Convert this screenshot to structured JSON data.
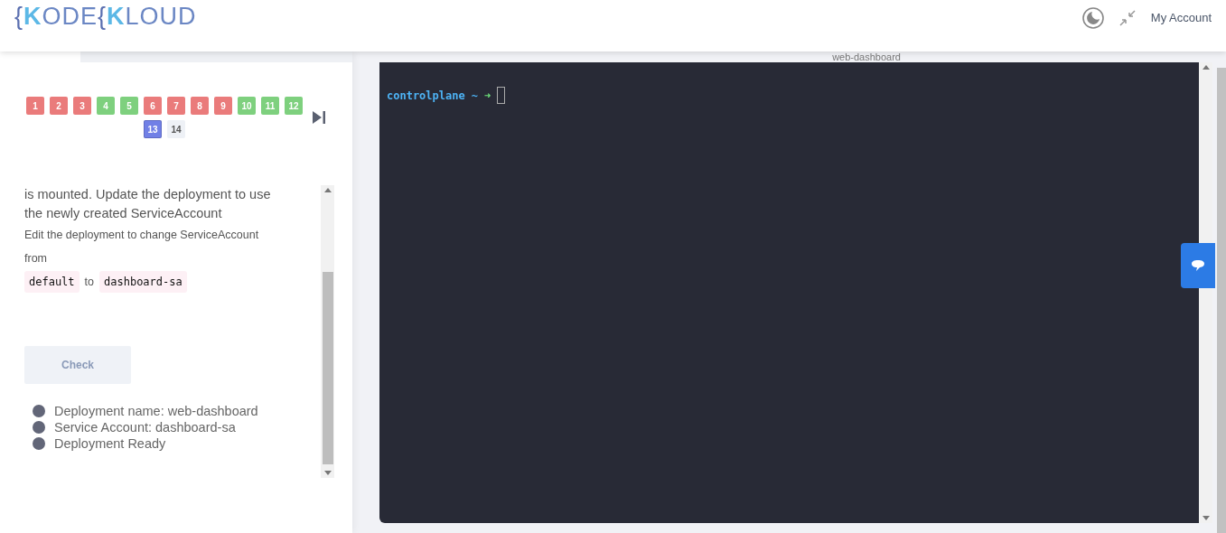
{
  "header": {
    "logo": {
      "brace": "{",
      "k": "K",
      "ode": "ODE",
      "brace2": "{",
      "k2": "K",
      "loud": "LOUD"
    },
    "account": "My Account"
  },
  "terminal_tab": {
    "label": "web-dashboard"
  },
  "questions": [
    {
      "label": "1",
      "color": "#ea7b7b",
      "selected": false
    },
    {
      "label": "2",
      "color": "#ea7b7b",
      "selected": false
    },
    {
      "label": "3",
      "color": "#ea7b7b",
      "selected": false
    },
    {
      "label": "4",
      "color": "#7ed07e",
      "selected": false
    },
    {
      "label": "5",
      "color": "#7ed07e",
      "selected": false
    },
    {
      "label": "6",
      "color": "#ea7b7b",
      "selected": false
    },
    {
      "label": "7",
      "color": "#ea7b7b",
      "selected": false
    },
    {
      "label": "8",
      "color": "#ea7b7b",
      "selected": false
    },
    {
      "label": "9",
      "color": "#ea7b7b",
      "selected": false
    },
    {
      "label": "10",
      "color": "#7ed07e",
      "selected": false
    },
    {
      "label": "11",
      "color": "#7ed07e",
      "selected": false
    },
    {
      "label": "12",
      "color": "#7ed07e",
      "selected": false
    },
    {
      "label": "13",
      "color": "#7180e6",
      "selected": true
    },
    {
      "label": "14",
      "color": "#eef1f6",
      "selected": false
    }
  ],
  "task": {
    "intro": "is mounted. Update the deployment to use the newly created ServiceAccount",
    "hint": [
      {
        "kind": "text",
        "text": "Edit the deployment to change ServiceAccount from"
      },
      {
        "kind": "code",
        "text": "default"
      },
      {
        "kind": "text",
        "text": "to"
      },
      {
        "kind": "code",
        "text": "dashboard-sa"
      }
    ],
    "check_button": "Check",
    "checks": [
      "Deployment name: web-dashboard",
      "Service Account: dashboard-sa",
      "Deployment Ready"
    ]
  },
  "terminal": {
    "host": "controlplane",
    "path": "~",
    "arrow": "➜"
  }
}
